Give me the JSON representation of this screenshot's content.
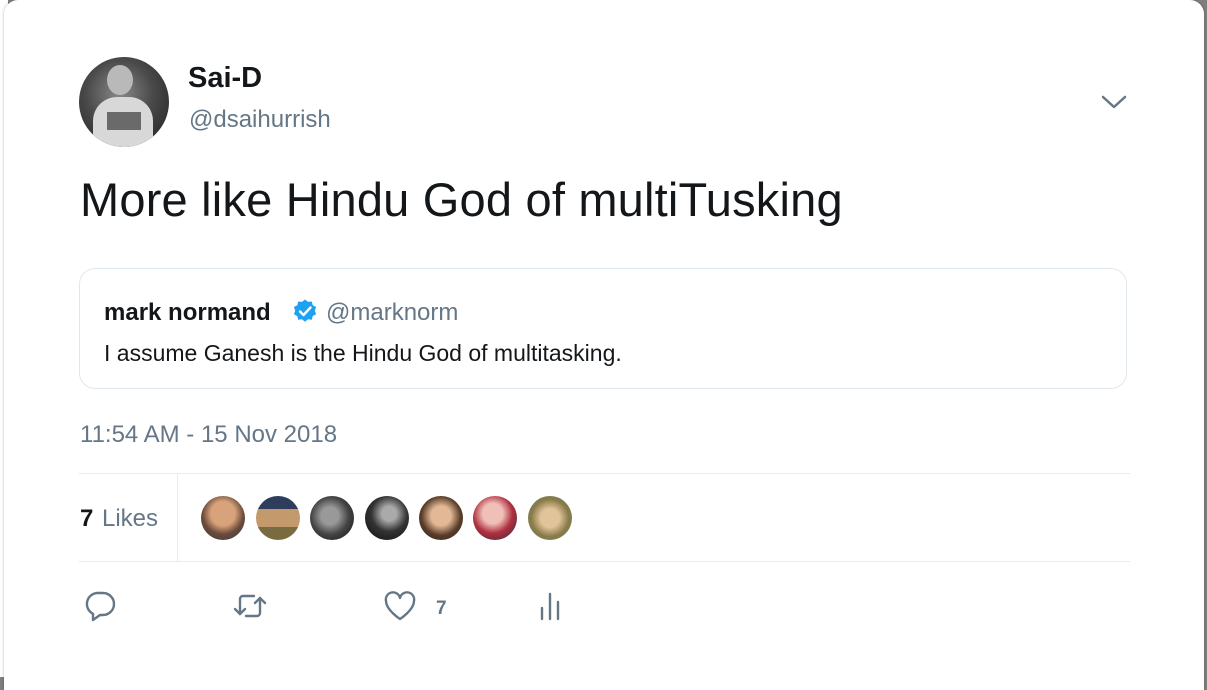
{
  "tweet": {
    "author": {
      "display_name": "Sai-D",
      "handle": "@dsaihurrish",
      "avatar_icon": "profile-photo"
    },
    "text": "More like Hindu God of multiTusking",
    "quoted": {
      "display_name": "mark normand",
      "verified_icon": "verified-badge-icon",
      "handle": "@marknorm",
      "text": "I assume Ganesh is the Hindu God of multitasking."
    },
    "timestamp": "11:54 AM - 15 Nov 2018",
    "likes": {
      "count": "7",
      "label": "Likes",
      "likers": [
        {
          "icon": "liker-avatar"
        },
        {
          "icon": "liker-avatar"
        },
        {
          "icon": "liker-avatar"
        },
        {
          "icon": "liker-avatar"
        },
        {
          "icon": "liker-avatar"
        },
        {
          "icon": "liker-avatar"
        },
        {
          "icon": "liker-avatar"
        }
      ]
    },
    "actions": {
      "reply_icon": "reply-icon",
      "retweet_icon": "retweet-icon",
      "like_icon": "heart-icon",
      "like_count": "7",
      "analytics_icon": "analytics-icon"
    }
  },
  "colors": {
    "text_primary": "#14171a",
    "text_secondary": "#657786",
    "border": "#e1e8ed",
    "verified_blue": "#1da1f2"
  }
}
